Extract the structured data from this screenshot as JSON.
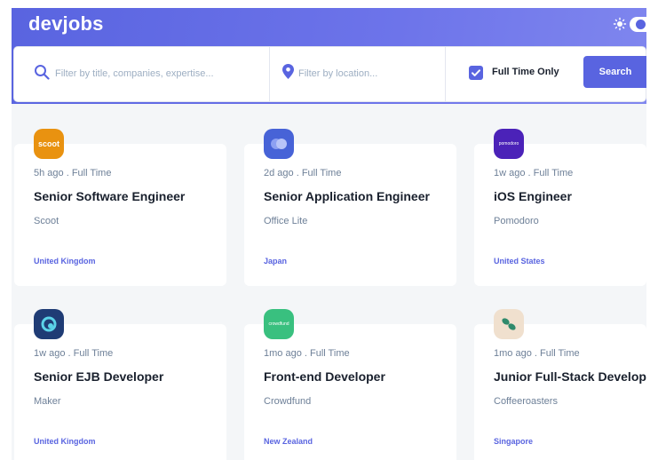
{
  "header": {
    "logo": "devjobs",
    "icons": {
      "theme": "sun-icon",
      "toggle": "theme-toggle"
    }
  },
  "search": {
    "title_placeholder": "Filter by title, companies, expertise...",
    "title_value": "",
    "location_placeholder": "Filter by location...",
    "location_value": "",
    "fulltime_label": "Full Time Only",
    "fulltime_checked": true,
    "button_label": "Search",
    "icons": {
      "search": "search-icon",
      "location": "location-pin-icon",
      "checkbox": "check-icon"
    }
  },
  "colors": {
    "accent": "#5964e0",
    "background": "#f4f6f8",
    "text": "#19202d",
    "muted": "#6e8098"
  },
  "jobs": [
    {
      "logo_text": "scoot",
      "logo_color": "#e99210",
      "meta": "5h ago . Full Time",
      "title": "Senior Software Engineer",
      "company": "Scoot",
      "location": "United Kingdom"
    },
    {
      "logo_text": "",
      "logo_color": "#4763d7",
      "meta": "2d ago . Full Time",
      "title": "Senior Application Engineer",
      "company": "Office Lite",
      "location": "Japan"
    },
    {
      "logo_text": "pomodoro",
      "logo_color": "#4b22b8",
      "meta": "1w ago . Full Time",
      "title": "iOS Engineer",
      "company": "Pomodoro",
      "location": "United States"
    },
    {
      "logo_text": "",
      "logo_color": "#1f3c75",
      "meta": "1w ago . Full Time",
      "title": "Senior EJB Developer",
      "company": "Maker",
      "location": "United Kingdom"
    },
    {
      "logo_text": "crowdfund",
      "logo_color": "#39c07f",
      "meta": "1mo ago . Full Time",
      "title": "Front-end Developer",
      "company": "Crowdfund",
      "location": "New Zealand"
    },
    {
      "logo_text": "",
      "logo_color": "#f0e0ce",
      "meta": "1mo ago . Full Time",
      "title": "Junior Full-Stack Developer",
      "company": "Coffeeroasters",
      "location": "Singapore"
    }
  ]
}
